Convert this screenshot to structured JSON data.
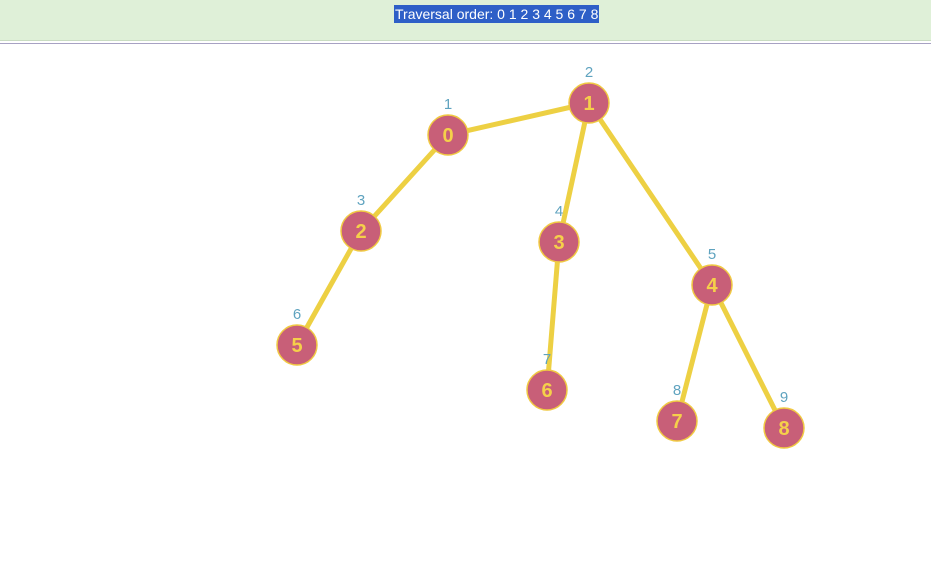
{
  "header": {
    "traversal_label": "Traversal order: 0 1 2 3 4 5 6 7 8"
  },
  "colors": {
    "header_bg": "#dff0d8",
    "label_bg": "#2e5fc7",
    "node_fill": "#c85f78",
    "node_text": "#f5d04a",
    "edge": "#edd043",
    "order_number": "#5fa3bf"
  },
  "tree": {
    "nodes": [
      {
        "id": "0",
        "order": "1"
      },
      {
        "id": "1",
        "order": "2"
      },
      {
        "id": "2",
        "order": "3"
      },
      {
        "id": "3",
        "order": "4"
      },
      {
        "id": "4",
        "order": "5"
      },
      {
        "id": "5",
        "order": "6"
      },
      {
        "id": "6",
        "order": "7"
      },
      {
        "id": "7",
        "order": "8"
      },
      {
        "id": "8",
        "order": "9"
      }
    ],
    "edges": [
      [
        "1",
        "0"
      ],
      [
        "1",
        "3"
      ],
      [
        "1",
        "4"
      ],
      [
        "0",
        "2"
      ],
      [
        "2",
        "5"
      ],
      [
        "3",
        "6"
      ],
      [
        "4",
        "7"
      ],
      [
        "4",
        "8"
      ]
    ]
  }
}
